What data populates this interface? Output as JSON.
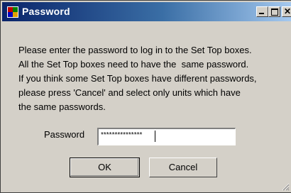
{
  "window": {
    "title": "Password",
    "minimize_glyph": "_",
    "maximize_glyph": "□",
    "close_glyph": "✕"
  },
  "message": {
    "lines": [
      "Please enter the password to log in to the Set Top boxes.",
      "All the Set Top boxes need to have the  same password.",
      "If you think some Set Top boxes have different passwords,",
      "please press 'Cancel' and select only units which have",
      "the same passwords."
    ]
  },
  "password": {
    "label": "Password",
    "value": "***************"
  },
  "buttons": {
    "ok": "OK",
    "cancel": "Cancel"
  },
  "colors": {
    "titlebar_start": "#0a246a",
    "titlebar_end": "#a6caf0",
    "face": "#d4d0c8"
  }
}
